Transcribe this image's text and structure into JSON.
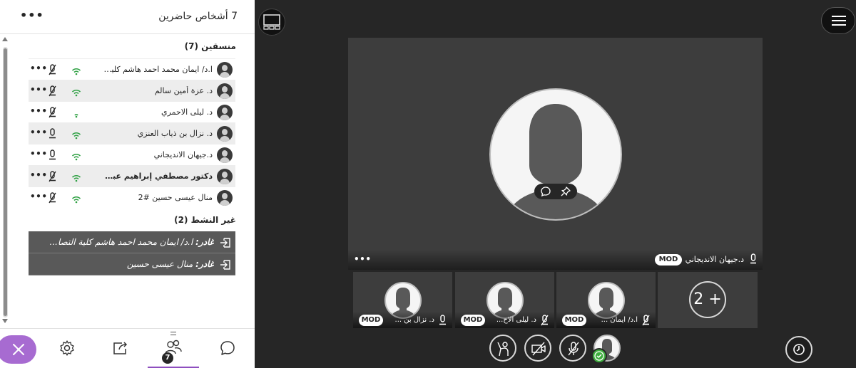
{
  "panel": {
    "title": "7 أشخاص حاضرين",
    "more_label": "•••"
  },
  "moderators": {
    "heading": "منسقين (7)",
    "items": [
      {
        "name": "ا.د/ ايمان محمد احمد هاشم كلية التصا...",
        "bold": false,
        "mic": "muted",
        "signal": "good"
      },
      {
        "name": "د. عزة أمين سالم",
        "bold": false,
        "mic": "muted",
        "signal": "good"
      },
      {
        "name": "د. ليلى الاحمري",
        "bold": false,
        "mic": "muted",
        "signal": "weak"
      },
      {
        "name": "د. نزال بن ذياب العنزي",
        "bold": false,
        "mic": "on",
        "signal": "good"
      },
      {
        "name": "د.جيهان الانديجاني",
        "bold": false,
        "mic": "on",
        "signal": "good"
      },
      {
        "name": "دكتور مصطفي إبراهيم عبدالرحمن ال...",
        "bold": true,
        "mic": "muted",
        "signal": "good"
      },
      {
        "name": "منال عيسى حسين #2",
        "bold": false,
        "mic": "muted",
        "signal": "good"
      }
    ],
    "row_more": "•••"
  },
  "inactive": {
    "heading": "غير النشط (2)",
    "items": [
      {
        "prefix": "غادر:",
        "name": " ا.د/ ايمان محمد احمد هاشم كلية التصا..."
      },
      {
        "prefix": "غادر:",
        "name": " منال عيسى حسين"
      }
    ]
  },
  "bottom_tabs": {
    "participants_count": "7",
    "tabs": [
      "close",
      "settings",
      "share",
      "participants",
      "chat"
    ]
  },
  "stage": {
    "main": {
      "name": "د.جيهان الانديجاني",
      "badge": "MOD",
      "more_label": "•••"
    },
    "thumbs": [
      {
        "name": "د. نزال بن ...",
        "badge": "MOD",
        "mic": "on"
      },
      {
        "name": "د. ليلى الاح...",
        "badge": "MOD",
        "mic": "muted"
      },
      {
        "name": "ا.د/ ايمان ...",
        "badge": "MOD",
        "mic": "muted"
      }
    ],
    "more_count": "2 +"
  },
  "colors": {
    "accent_purple": "#8e4fbf",
    "close_button": "#a76bd1",
    "signal_green": "#2ea043",
    "stage_bg": "#262626"
  }
}
